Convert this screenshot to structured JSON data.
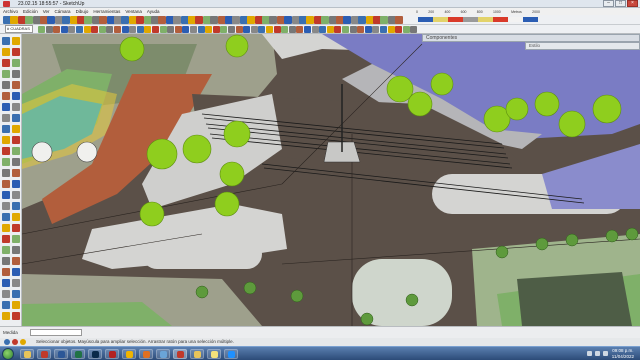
{
  "window": {
    "title": "23.02.15 18:55:57 - SketchUp",
    "controls": [
      "–",
      "□",
      "×"
    ]
  },
  "menu": [
    "Archivo",
    "Edición",
    "Ver",
    "Cámara",
    "Dibujo",
    "Herramientas",
    "Ventana",
    "Ayuda"
  ],
  "toolbar": {
    "layer_value": "# CUADRAS",
    "legend_labels": [
      "0",
      "200",
      "400",
      "600",
      "800",
      "1000",
      "Metros",
      "2000"
    ],
    "legend_colors": [
      "#2b5db3",
      "#e3d36a",
      "#d93a2a",
      "#9a9a9a",
      "#e3d36a",
      "#d93a2a",
      "#f2f2f2",
      "#2b5db3"
    ]
  },
  "panels": {
    "components_title": "Componentes",
    "components_sub": "Estilo"
  },
  "status": {
    "measurements_label": "Medida",
    "measurements_value": "",
    "hint": "Seleccionar objetos. Mayúscula para ampliar selección. Arrastrar ratón para una selección múltiple."
  },
  "taskbar": {
    "time": "09:08 p.m.",
    "date": "11/04/2022",
    "apps": [
      {
        "name": "explorer",
        "color": "#e8c45a"
      },
      {
        "name": "sketchup",
        "color": "#c0392b"
      },
      {
        "name": "word",
        "color": "#2b5797"
      },
      {
        "name": "excel",
        "color": "#207245"
      },
      {
        "name": "photoshop",
        "color": "#0a2a4a"
      },
      {
        "name": "autocad",
        "color": "#b22222"
      },
      {
        "name": "chrome",
        "color": "#f0b400"
      },
      {
        "name": "mediaplayer",
        "color": "#e07020"
      },
      {
        "name": "paint",
        "color": "#6aa4d8"
      },
      {
        "name": "sketchup-active",
        "color": "#c0392b"
      },
      {
        "name": "folder",
        "color": "#e8c45a"
      },
      {
        "name": "notes",
        "color": "#f4e27a"
      },
      {
        "name": "ie",
        "color": "#1e90ff"
      }
    ]
  },
  "colors": {
    "road": "#5b5048",
    "sidewalk": "#d4d4d2",
    "plaza_gray": "#9ea08c",
    "plaza_green": "#7fb069",
    "building": "#7a7cc4",
    "brick": "#b25e3c",
    "tree": "#8fce1e"
  }
}
